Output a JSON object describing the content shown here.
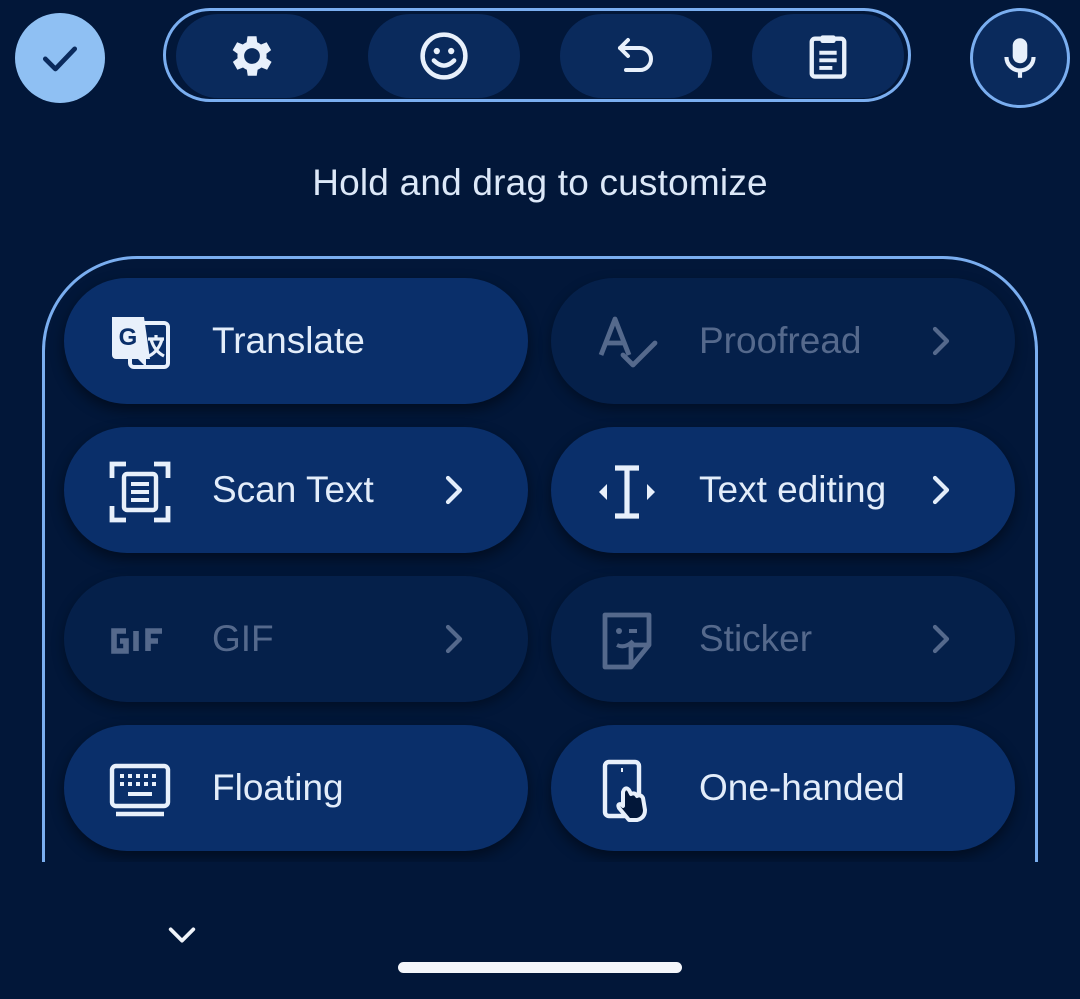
{
  "toolbar": {
    "done_icon": "check-icon",
    "tools": [
      {
        "name": "settings",
        "icon": "gear-icon"
      },
      {
        "name": "emoji",
        "icon": "emoji-icon"
      },
      {
        "name": "undo",
        "icon": "undo-icon"
      },
      {
        "name": "clipboard",
        "icon": "clipboard-icon"
      }
    ],
    "mic_icon": "microphone-icon"
  },
  "hint_text": "Hold and drag to customize",
  "features": [
    {
      "label": "Translate",
      "icon": "translate-icon",
      "enabled": true,
      "has_chevron": false
    },
    {
      "label": "Proofread",
      "icon": "proofread-icon",
      "enabled": false,
      "has_chevron": true
    },
    {
      "label": "Scan Text",
      "icon": "scan-text-icon",
      "enabled": true,
      "has_chevron": true
    },
    {
      "label": "Text editing",
      "icon": "text-cursor-icon",
      "enabled": true,
      "has_chevron": true
    },
    {
      "label": "GIF",
      "icon": "gif-icon",
      "enabled": false,
      "has_chevron": true
    },
    {
      "label": "Sticker",
      "icon": "sticker-icon",
      "enabled": false,
      "has_chevron": true
    },
    {
      "label": "Floating",
      "icon": "keyboard-icon",
      "enabled": true,
      "has_chevron": false
    },
    {
      "label": "One-handed",
      "icon": "one-handed-icon",
      "enabled": true,
      "has_chevron": false
    }
  ],
  "colors": {
    "background": "#021739",
    "accent": "#8fc0f3",
    "pill": "#0a2f6a",
    "pill_disabled": "#05204a",
    "outline": "#7aaef0"
  }
}
